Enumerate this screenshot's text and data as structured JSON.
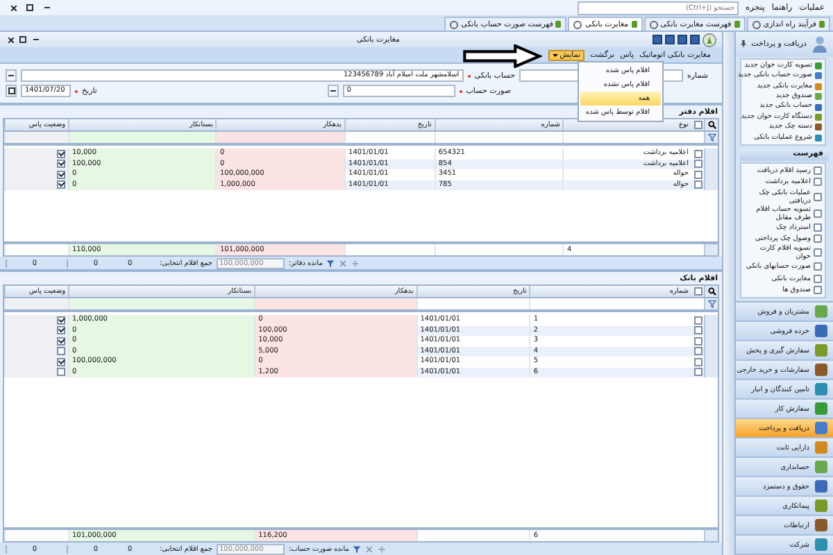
{
  "menu_bar": {
    "items": [
      "عملیات",
      "راهنما",
      "پنجره"
    ],
    "search": {
      "placeholder": "جستجو (Ctrl+J)"
    }
  },
  "tabs": [
    {
      "label": "فرآیند راه اندازی",
      "selected": false
    },
    {
      "label": "فهرست مغایرت بانکی",
      "selected": false
    },
    {
      "label": "مغایرت بانکی",
      "selected": true
    },
    {
      "label": "فهرست صورت حساب بانکی",
      "selected": false
    }
  ],
  "sidebar": {
    "header": "دریافت و پرداخت",
    "new_items": [
      "تسویه کارت خوان جدید",
      "صورت حساب بانکی جدید",
      "مغایرت بانکی جدید",
      "صندوق جدید",
      "حساب بانکی جدید",
      "دستگاه کارت خوان جدید",
      "دسته چک جدید",
      "شروع عملیات بانکی"
    ],
    "list_header": "فهرست",
    "list_items": [
      "رسید اقلام دریافت",
      "اعلامیه برداشت",
      "عملیات بانکی چک دریافتی",
      "تسویه حساب اقلام طرف مقابل",
      "استرداد چک",
      "وصول چک پرداختی",
      "تسویه اقلام کارت خوان",
      "صورت حسابهای بانکی",
      "مغایرت بانکی",
      "صندوق ها"
    ],
    "modules": [
      {
        "label": "مشتریان و فروش",
        "selected": false
      },
      {
        "label": "خرده فروشی",
        "selected": false
      },
      {
        "label": "سفارش گیری و پخش",
        "selected": false
      },
      {
        "label": "سفارشات و خرید خارجی",
        "selected": false
      },
      {
        "label": "تامین کنندگان و انبار",
        "selected": false
      },
      {
        "label": "سفارش کار",
        "selected": false
      },
      {
        "label": "دریافت و پرداخت",
        "selected": true
      },
      {
        "label": "دارایی ثابت",
        "selected": false
      },
      {
        "label": "حسابداری",
        "selected": false
      },
      {
        "label": "حقوق و دستمزد",
        "selected": false
      },
      {
        "label": "پیمانکاری",
        "selected": false
      },
      {
        "label": "ارتباطات",
        "selected": false
      },
      {
        "label": "شرکت",
        "selected": false
      }
    ]
  },
  "form": {
    "title": "مغایرت بانکی",
    "toolbar_menu": [
      "مغایرت بانکی اتوماتیک",
      "پاس",
      "برگشت"
    ],
    "show_menu": {
      "label": "نمایش",
      "options": [
        {
          "label": "اقلام پاس شده",
          "selected": false
        },
        {
          "label": "اقلام پاس نشده",
          "selected": false
        },
        {
          "label": "همه",
          "selected": true
        },
        {
          "label": "اقلام توسط پاس شده",
          "selected": false
        }
      ]
    },
    "fields": {
      "number_label": "شماره",
      "account_label": "حساب بانکی",
      "account_value": "اسلامشهر ملت اسلام آباد 123456789",
      "statement_label": "صورت حساب",
      "statement_value": "0",
      "date_label": "تاریخ",
      "date_value": "1401/07/20"
    },
    "tables": [
      {
        "title": "اقلام دفتر",
        "columns": [
          {
            "label": "نوع",
            "kind": "text"
          },
          {
            "label": "شماره",
            "kind": "number"
          },
          {
            "label": "تاریخ",
            "kind": "date"
          },
          {
            "label": "بدهکار",
            "kind": "debit"
          },
          {
            "label": "بستانکار",
            "kind": "credit"
          },
          {
            "label": "وضعیت پاس",
            "kind": "status"
          }
        ],
        "all_selected": false,
        "rows": [
          {
            "cells": [
              "اعلامیه برداشت",
              "654321",
              "1401/01/01",
              "0",
              "10,000"
            ],
            "selected": false,
            "checked": true
          },
          {
            "cells": [
              "اعلامیه برداشت",
              "854",
              "1401/01/01",
              "0",
              "100,000"
            ],
            "selected": false,
            "checked": true
          },
          {
            "cells": [
              "حواله",
              "3451",
              "1401/01/01",
              "100,000,000",
              "0"
            ],
            "selected": false,
            "checked": true
          },
          {
            "cells": [
              "حواله",
              "785",
              "1401/01/01",
              "1,000,000",
              "0"
            ],
            "selected": false,
            "checked": true
          }
        ],
        "totals": {
          "count": "4",
          "debit": "101,000,000",
          "credit": "110,000"
        },
        "footer": {
          "balance_label": "مانده دفاتر:",
          "balance_value": "100,000,000",
          "sum_label": "جمع اقلام انتخابی:",
          "sum_value": "0",
          "values": [
            "0",
            "0"
          ]
        }
      },
      {
        "title": "اقلام بانک",
        "columns": [
          {
            "label": "شماره",
            "kind": "number"
          },
          {
            "label": "تاریخ",
            "kind": "date"
          },
          {
            "label": "بدهکار",
            "kind": "debit"
          },
          {
            "label": "بستانکار",
            "kind": "credit"
          },
          {
            "label": "وضعیت پاس",
            "kind": "status"
          }
        ],
        "all_selected": false,
        "rows": [
          {
            "cells": [
              "1",
              "1401/01/01",
              "0",
              "1,000,000"
            ],
            "selected": false,
            "checked": true
          },
          {
            "cells": [
              "2",
              "1401/01/01",
              "100,000",
              "0"
            ],
            "selected": false,
            "checked": true
          },
          {
            "cells": [
              "3",
              "1401/01/01",
              "10,000",
              "0"
            ],
            "selected": false,
            "checked": true
          },
          {
            "cells": [
              "4",
              "1401/01/01",
              "5,000",
              "0"
            ],
            "selected": false,
            "checked": false
          },
          {
            "cells": [
              "5",
              "1401/01/01",
              "0",
              "100,000,000"
            ],
            "selected": false,
            "checked": true
          },
          {
            "cells": [
              "6",
              "1401/01/01",
              "1,200",
              "0"
            ],
            "selected": false,
            "checked": false
          }
        ],
        "totals": {
          "count": "6",
          "debit": "116,200",
          "credit": "101,000,000"
        },
        "footer": {
          "balance_label": "مانده صورت حساب:",
          "balance_value": "100,000,000",
          "sum_label": "جمع اقلام انتخابی:",
          "sum_value": "0",
          "values": [
            "0",
            "0"
          ]
        }
      }
    ]
  }
}
